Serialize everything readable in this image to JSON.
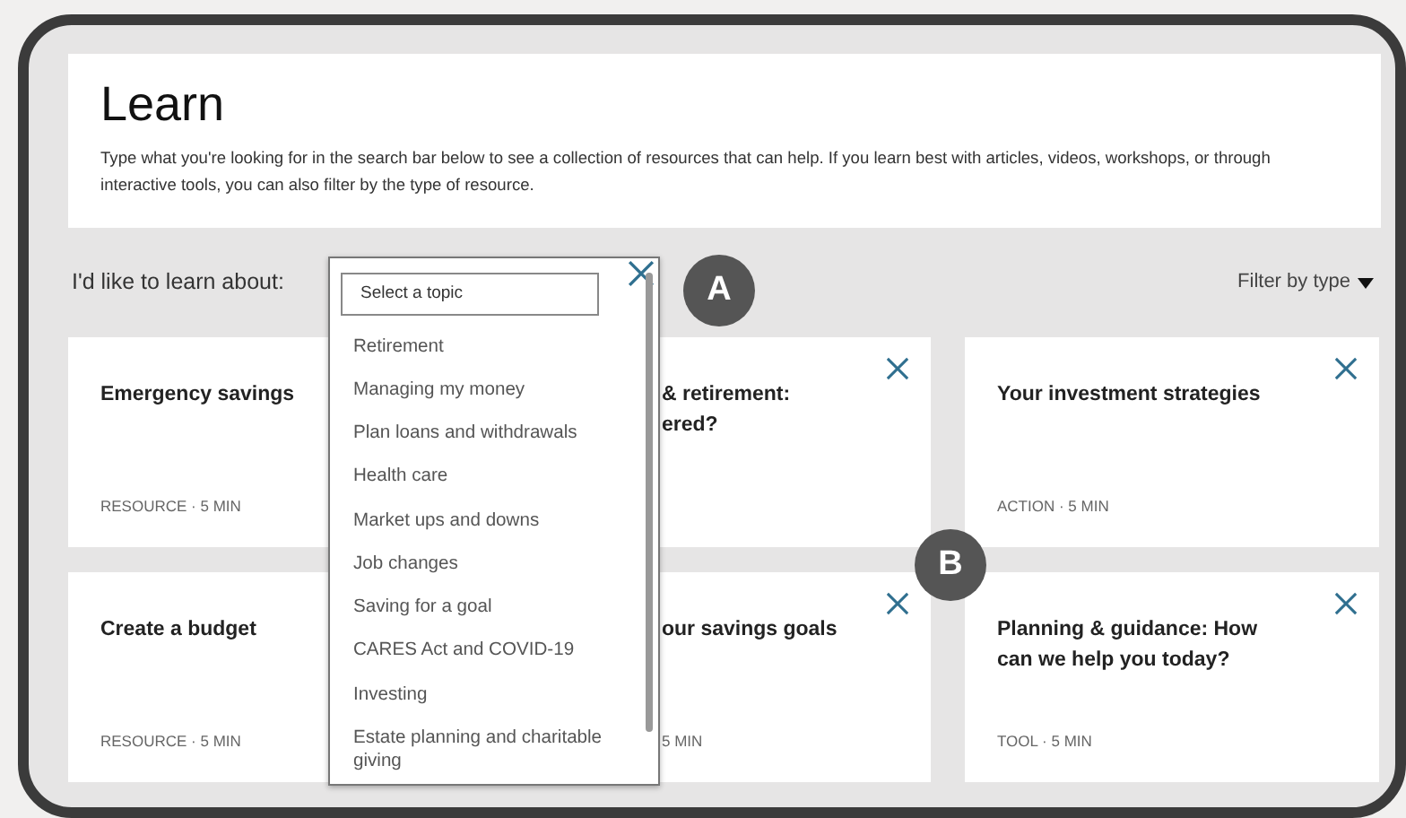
{
  "header": {
    "title": "Learn",
    "description": "Type what you're looking for in the search bar below to see a collection of resources that can help. If you learn best with articles, videos, workshops, or through interactive tools, you can also filter by the type of resource."
  },
  "topic_picker": {
    "label": "I'd like to learn about:",
    "placeholder": "Select a topic",
    "expanded": true,
    "options": [
      "Retirement",
      "Managing my money",
      "Plan loans and withdrawals",
      "Health care",
      "Market ups and downs",
      "Job changes",
      "Saving for a goal",
      "CARES Act and COVID-19",
      "Investing",
      "Estate planning and charitable giving"
    ]
  },
  "filter": {
    "label": "Filter by type"
  },
  "cards": [
    {
      "title_lines": [
        "Emergency savings"
      ],
      "meta": "RESOURCE · 5 MIN",
      "covered": false
    },
    {
      "title_lines": [
        "& retirement:",
        "ered?"
      ],
      "covered": true
    },
    {
      "title_lines": [
        "Your investment strategies"
      ],
      "meta": "ACTION · 5 MIN",
      "covered": false
    },
    {
      "title_lines": [
        "Create a budget"
      ],
      "meta": "RESOURCE · 5 MIN",
      "covered": false
    },
    {
      "title_lines": [
        "our savings goals"
      ],
      "meta": "5 MIN",
      "covered": true
    },
    {
      "title_lines": [
        "Planning & guidance: How",
        "can we help you today?"
      ],
      "meta": "TOOL · 5 MIN",
      "covered": false
    }
  ],
  "callouts": [
    {
      "label": "A"
    },
    {
      "label": "B"
    }
  ]
}
